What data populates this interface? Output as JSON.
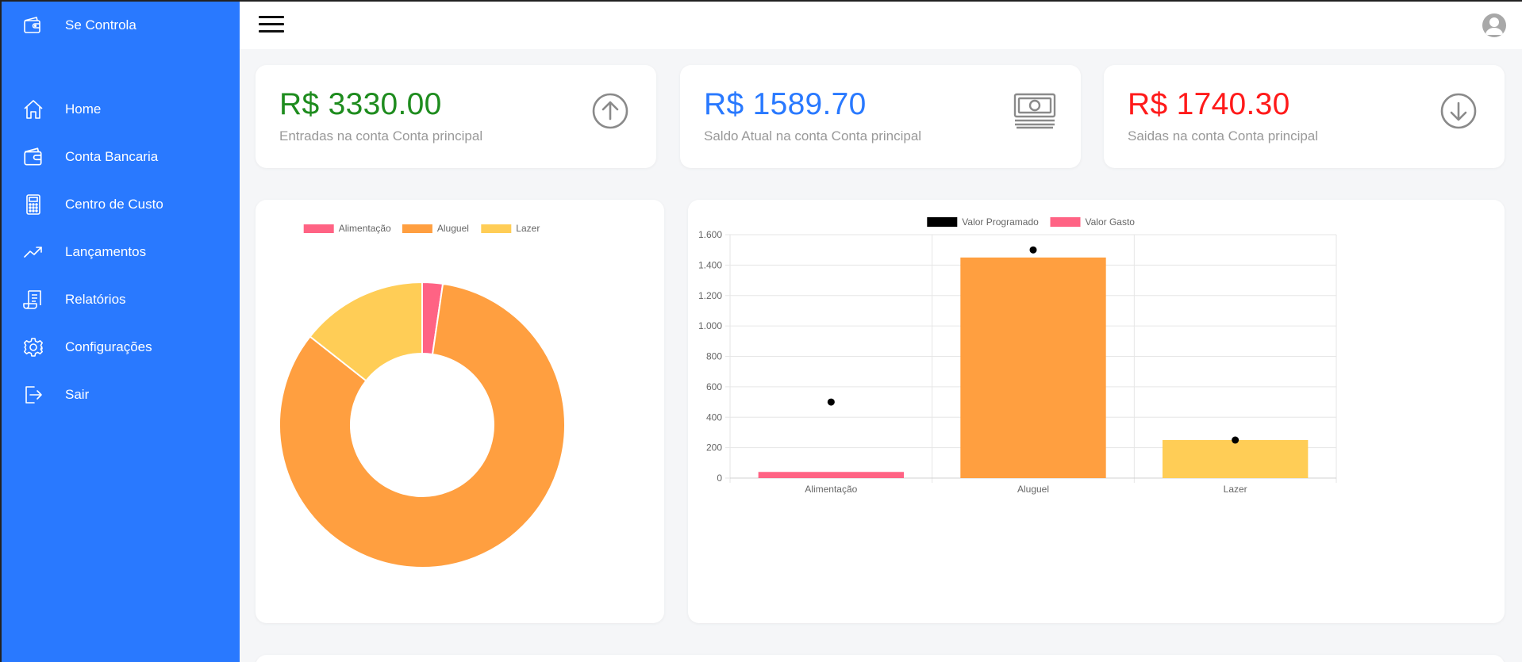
{
  "app": {
    "brand_name": "Se Controla",
    "brand_icon": "wallet-icon",
    "accent": "#2979ff"
  },
  "sidebar": {
    "items": [
      {
        "label": "Home",
        "icon": "home-icon"
      },
      {
        "label": "Conta Bancaria",
        "icon": "wallet-icon"
      },
      {
        "label": "Centro de Custo",
        "icon": "calculator-icon"
      },
      {
        "label": "Lançamentos",
        "icon": "trending-up-icon"
      },
      {
        "label": "Relatórios",
        "icon": "receipt-icon"
      },
      {
        "label": "Configurações",
        "icon": "gear-icon"
      },
      {
        "label": "Sair",
        "icon": "logout-icon"
      }
    ]
  },
  "topbar": {
    "menu_icon": "hamburger-icon",
    "avatar_icon": "user-avatar-icon"
  },
  "stats": [
    {
      "amount": "R$ 3330.00",
      "caption": "Entradas na conta Conta principal",
      "color": "#1e8c1e",
      "icon": "arrow-up-circle-icon"
    },
    {
      "amount": "R$ 1589.70",
      "caption": "Saldo Atual na conta Conta principal",
      "color": "#2979ff",
      "icon": "money-bill-icon"
    },
    {
      "amount": "R$ 1740.30",
      "caption": "Saidas na conta Conta principal",
      "color": "#ff1a1a",
      "icon": "arrow-down-circle-icon"
    }
  ],
  "chart_data": [
    {
      "type": "pie",
      "variant": "doughnut",
      "categories": [
        "Alimentação",
        "Aluguel",
        "Lazer"
      ],
      "values": [
        40.3,
        1450,
        250
      ],
      "colors": [
        "#ff6384",
        "#ff9f40",
        "#ffcd56"
      ],
      "legend": "top"
    },
    {
      "type": "bar",
      "categories": [
        "Alimentação",
        "Aluguel",
        "Lazer"
      ],
      "series": [
        {
          "name": "Valor Programado",
          "kind": "scatter",
          "values": [
            500,
            1500,
            250
          ],
          "color": "#000000"
        },
        {
          "name": "Valor Gasto",
          "kind": "bar",
          "values": [
            40.3,
            1450,
            250
          ],
          "colors": [
            "#ff6384",
            "#ff9f40",
            "#ffcd56"
          ],
          "legend_color": "#ff6384"
        }
      ],
      "ylim": [
        0,
        1600
      ],
      "yticks": [
        "0",
        "200",
        "400",
        "600",
        "800",
        "1.000",
        "1.200",
        "1.400",
        "1.600"
      ],
      "grid": true,
      "legend": "top"
    }
  ]
}
